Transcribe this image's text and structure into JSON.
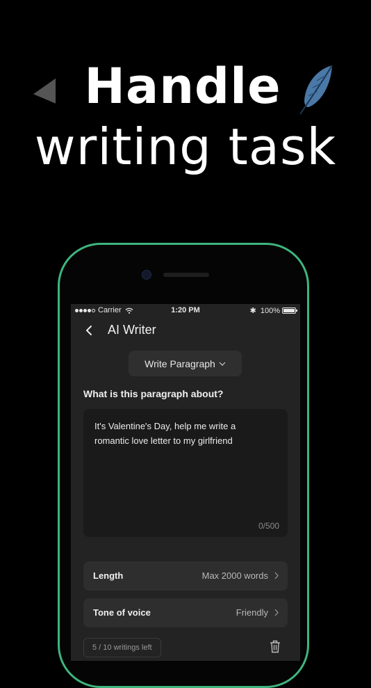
{
  "hero": {
    "title_line1": "Handle",
    "title_line2": "writing task",
    "decoration_icon": "feather-icon",
    "left_decoration_icon": "triangle-arrow-icon"
  },
  "status_bar": {
    "carrier": "Carrier",
    "time": "1:20 PM",
    "battery": "100%"
  },
  "nav": {
    "title": "AI Writer"
  },
  "mode_select": {
    "selected": "Write Paragraph"
  },
  "question": {
    "label": "What is this paragraph about?"
  },
  "prompt": {
    "text": "It's Valentine's Day, help me write a\nromantic love letter to my girlfriend",
    "count": "0/500"
  },
  "options": {
    "length_label": "Length",
    "length_value": "Max 2000 words",
    "tone_label": "Tone of voice",
    "tone_value": "Friendly"
  },
  "footer": {
    "writings_left": "5 / 10 writings left"
  },
  "colors": {
    "background": "#000000",
    "phone_border": "#3fb57e",
    "screen_bg": "#232323",
    "feather": "#4a79a8"
  }
}
